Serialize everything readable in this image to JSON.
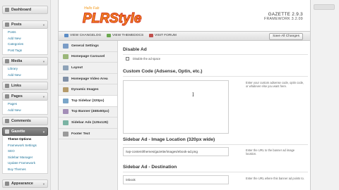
{
  "wp_menu": {
    "dashboard": "Dashboard",
    "posts": {
      "label": "Posts",
      "items": [
        "Posts",
        "Add New",
        "Categories",
        "Post Tags"
      ]
    },
    "media": {
      "label": "Media",
      "items": [
        "Library",
        "Add New"
      ]
    },
    "links": {
      "label": "Links"
    },
    "pages": {
      "label": "Pages",
      "items": [
        "Pages",
        "Add New"
      ]
    },
    "comments": {
      "label": "Comments"
    },
    "gazette": {
      "label": "Gazette",
      "items": [
        "Theme Options",
        "Framework Settings",
        "SEO",
        "Sidebar Manager",
        "Update Framework",
        "Buy Themes"
      ]
    },
    "appearance": {
      "label": "Appearance"
    }
  },
  "header": {
    "logo_small": "Hello Fab",
    "logo_text": "PLRStyle",
    "theme_version": "GAZETTE 2.9.3",
    "framework_version": "FRAMEWORK 3.2.09"
  },
  "toolbar": {
    "changelog": "VIEW CHANGELOG",
    "themedocs": "VIEW THEMEDOCS",
    "forum": "VISIT FORUM",
    "save_all": "Save All Changes"
  },
  "nav": {
    "items": [
      "General Settings",
      "Homepage Carousel",
      "Layout",
      "Homepage Video Area",
      "Dynamic Images",
      "Top Sidebar (320px)",
      "Top Banner (468x60px)",
      "Sidebar Ads (125x125)",
      "Footer Text"
    ]
  },
  "content": {
    "disable_ad_title": "Disable Ad",
    "disable_ad_checkbox_label": "Disable the ad space",
    "custom_code_title": "Custom Code (Adsense, Optin, etc.)",
    "custom_code_desc": "Enter your custom adsense code, optin code, or whatever else you want here.",
    "image_location_title": "Sidebar Ad - Image Location (320px wide)",
    "image_location_value": "/wp-content/themes/gazette/images/ebook-ad.png",
    "image_location_desc": "Enter the URL to the banner ad image location.",
    "destination_title": "Sidebar Ad - Destination",
    "destination_value": "/ebook",
    "destination_desc": "Enter the URL where this banner ad points to."
  },
  "colors": {
    "accent_link": "#21759b",
    "logo_red": "#d83a1e",
    "logo_orange": "#f39a1d"
  },
  "icons": {
    "changelog": "document-icon",
    "themedocs": "book-icon",
    "forum": "forum-icon",
    "cursor": "text-cursor-icon"
  }
}
